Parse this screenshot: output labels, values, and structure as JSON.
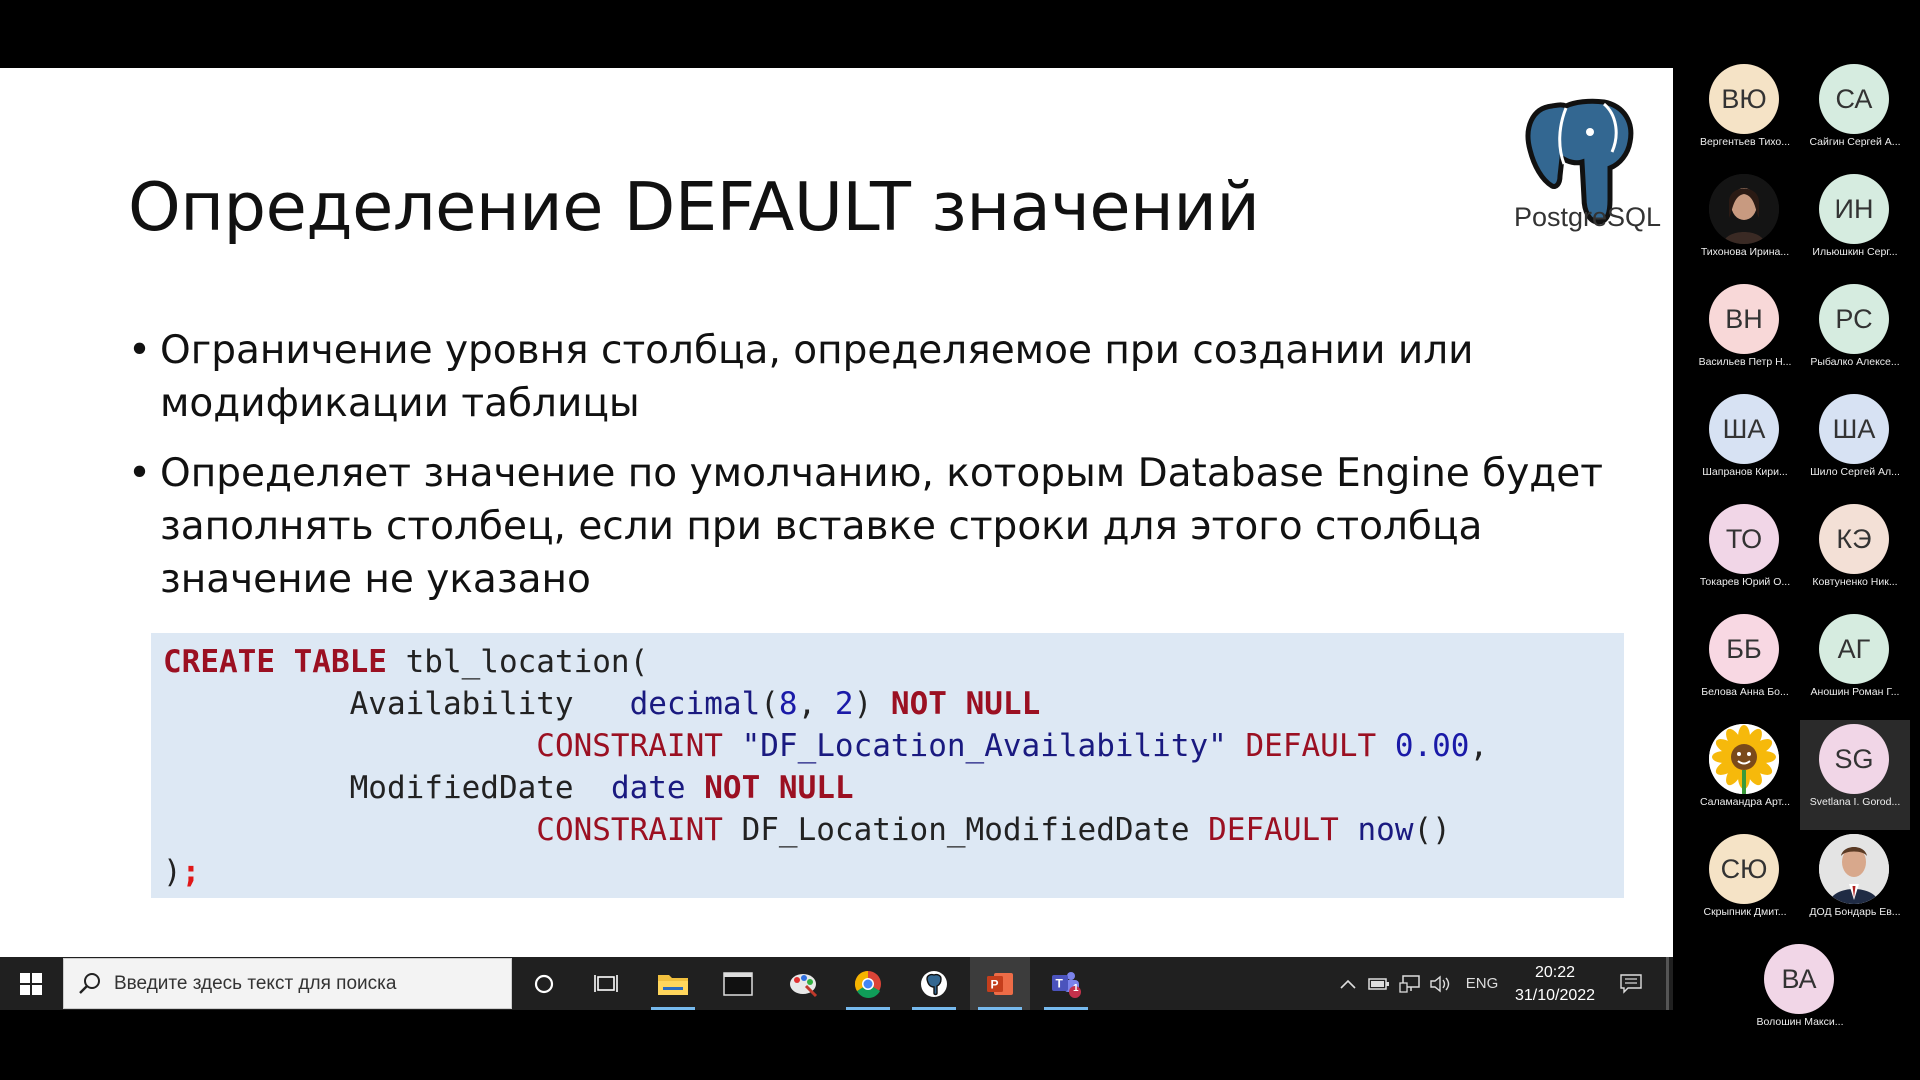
{
  "slide": {
    "title": "Определение DEFAULT значений",
    "logo_text": "PostgreSQL",
    "bullets": [
      "Ограничение уровня столбца, определяемое при создании или модификации таблицы",
      "Определяет значение по умолчанию, которым Database Engine будет заполнять столбец, если при вставке строки для этого столбца значение не указано"
    ],
    "code": {
      "l1": {
        "kw": "CREATE TABLE",
        "rest": " tbl_location("
      },
      "l2": {
        "indent": "          Availability   ",
        "type": "decimal",
        "p1": "(",
        "n1": "8",
        "comma": ", ",
        "n2": "2",
        "p2": ")",
        "kw": " NOT NULL"
      },
      "l3": {
        "indent": "                    ",
        "kw": "CONSTRAINT",
        "str": " \"DF_Location_Availability\"",
        "kw2": " DEFAULT",
        "num": " 0.00",
        "tail": ","
      },
      "l4": {
        "indent": "          ModifiedDate  ",
        "type": "date",
        "kw": " NOT NULL"
      },
      "l5": {
        "indent": "                    ",
        "kw": "CONSTRAINT",
        "mid": " DF_Location_ModifiedDate",
        "kw2": " DEFAULT",
        "fn": " now",
        "tail": "()"
      },
      "l6": {
        "close": ")",
        "semi": ";"
      }
    }
  },
  "participants": [
    {
      "initials": "ВЮ",
      "name": "Вергентьев Тихо...",
      "color": "#f5e3c6"
    },
    {
      "initials": "СА",
      "name": "Сайгин Сергей А...",
      "color": "#d6ece0"
    },
    {
      "initials": "",
      "name": "Тихонова Ирина...",
      "color": "#1a1a1a",
      "photo": "female-photo"
    },
    {
      "initials": "ИН",
      "name": "Ильюшкин Серг...",
      "color": "#d6ece0"
    },
    {
      "initials": "ВН",
      "name": "Васильев Петр Н...",
      "color": "#f8d8d8"
    },
    {
      "initials": "РС",
      "name": "Рыбалко Алексе...",
      "color": "#d6ece0"
    },
    {
      "initials": "ША",
      "name": "Шапранов Кири...",
      "color": "#d7e2f3"
    },
    {
      "initials": "ША",
      "name": "Шило Сергей Ал...",
      "color": "#d7e2f3"
    },
    {
      "initials": "ТО",
      "name": "Токарев Юрий О...",
      "color": "#f1d6e7"
    },
    {
      "initials": "КЭ",
      "name": "Ковтуненко Ник...",
      "color": "#f3e0d6"
    },
    {
      "initials": "ББ",
      "name": "Белова Анна Бо...",
      "color": "#f8d8e3"
    },
    {
      "initials": "АГ",
      "name": "Аношин Роман Г...",
      "color": "#d6ece0"
    },
    {
      "initials": "",
      "name": "Саламандра Арт...",
      "color": "#ffffff",
      "photo": "sunflower-icon"
    },
    {
      "initials": "SG",
      "name": "Svetlana I. Gorod...",
      "color": "#f1d6e7",
      "selected": true
    },
    {
      "initials": "СЮ",
      "name": "Скрыпник Дмит...",
      "color": "#f5e3c6"
    },
    {
      "initials": "",
      "name": "ДОД Бондарь Ев...",
      "color": "#e8e8e8",
      "photo": "male-photo"
    },
    {
      "initials": "ВА",
      "name": "Волошин Макси...",
      "color": "#f1d6e7"
    }
  ],
  "taskbar": {
    "search_placeholder": "Введите здесь текст для поиска",
    "lang": "ENG",
    "time": "20:22",
    "date": "31/10/2022",
    "teams_badge": "1",
    "accent": "#76b9ed"
  }
}
